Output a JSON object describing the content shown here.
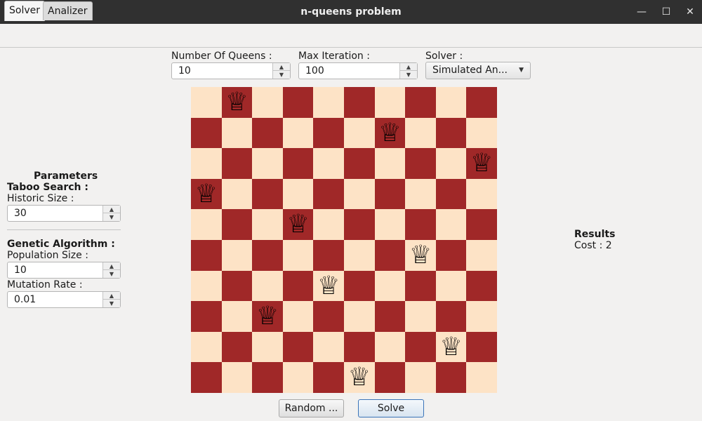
{
  "window": {
    "title": "n-queens problem",
    "minimize_glyph": "—",
    "maximize_glyph": "☐",
    "close_glyph": "✕"
  },
  "tabs": [
    {
      "label": "Solver"
    },
    {
      "label": "Analizer"
    }
  ],
  "top_controls": {
    "queens_label": "Number Of Queens :",
    "queens_value": "10",
    "iteration_label": "Max Iteration :",
    "iteration_value": "100",
    "solver_label": "Solver :",
    "solver_value": "Simulated An..."
  },
  "parameters": {
    "heading": "Parameters",
    "taboo_heading": "Taboo Search :",
    "historic_label": "Historic Size :",
    "historic_value": "30",
    "genetic_heading": "Genetic Algorithm :",
    "population_label": "Population Size :",
    "population_value": "10",
    "mutation_label": "Mutation Rate :",
    "mutation_value": "0.01"
  },
  "board": {
    "size": 10,
    "queens": [
      1,
      6,
      9,
      0,
      3,
      7,
      4,
      2,
      8,
      5
    ],
    "light_color": "#fde3c6",
    "dark_color": "#a02828",
    "queen_glyph": "♕"
  },
  "results": {
    "heading": "Results",
    "cost": "Cost : 2"
  },
  "buttons": {
    "random": "Random ...",
    "solve": "Solve"
  }
}
